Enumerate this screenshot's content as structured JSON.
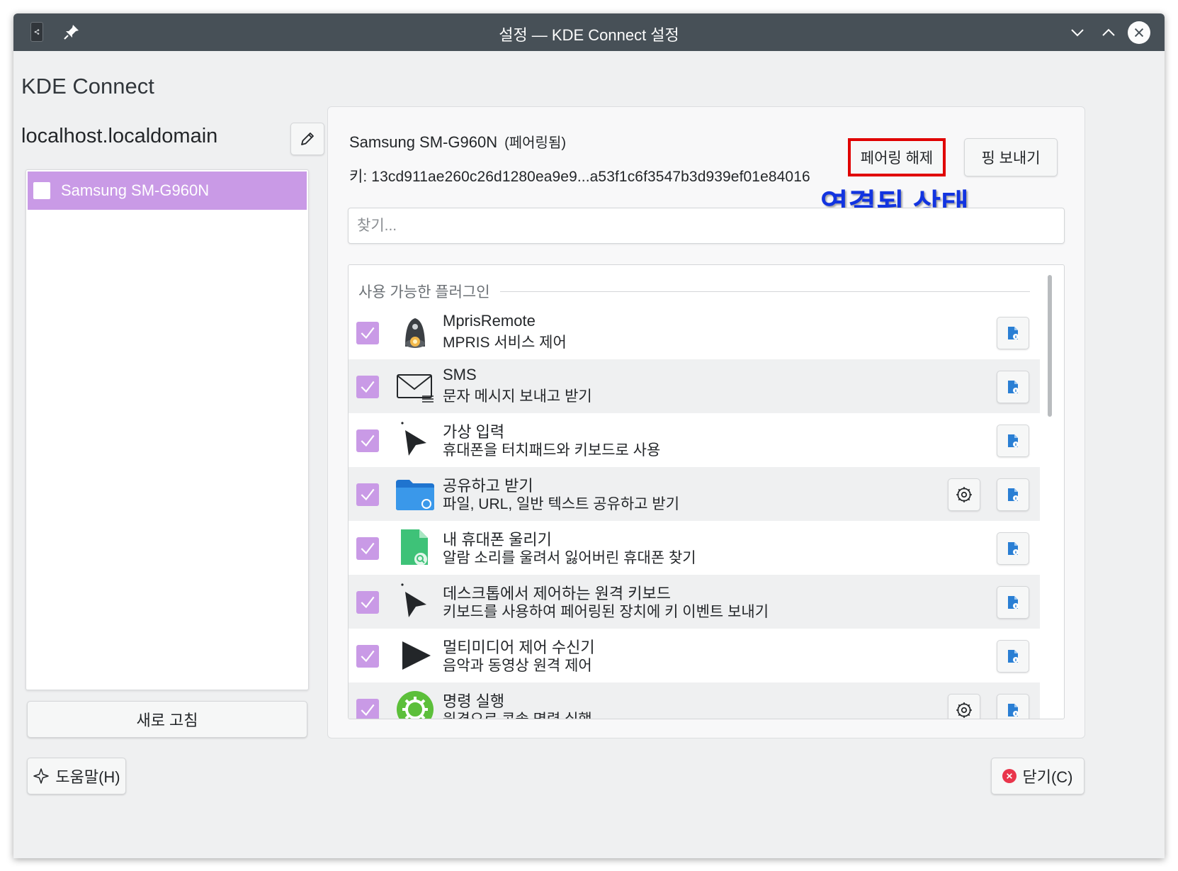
{
  "window": {
    "title": "설정 — KDE Connect 설정"
  },
  "app_heading": "KDE Connect",
  "host": {
    "name": "localhost.localdomain"
  },
  "devices": [
    {
      "label": "Samsung SM-G960N",
      "selected": true
    }
  ],
  "refresh_label": "새로 고침",
  "device_panel": {
    "name": "Samsung SM-G960N",
    "status": "(페어링됨)",
    "key_label": "키: 13cd911ae260c26d1280ea9e9...a53f1c6f3547b3d939ef01e84016",
    "unpair_label": "페어링 해제",
    "ping_label": "핑 보내기",
    "annotation": "연결된 상태",
    "search_placeholder": "찾기...",
    "section_title": "사용 가능한 플러그인"
  },
  "plugins": [
    {
      "name": "MprisRemote",
      "description": "MPRIS 서비스 제어",
      "enabled": true,
      "icon": "mpris-remote-icon",
      "has_settings": false
    },
    {
      "name": "SMS",
      "description": "문자 메시지 보내고 받기",
      "enabled": true,
      "icon": "envelope-icon",
      "has_settings": false
    },
    {
      "name": "가상 입력",
      "description": "휴대폰을 터치패드와 키보드로 사용",
      "enabled": true,
      "icon": "pointer-icon",
      "has_settings": false
    },
    {
      "name": "공유하고 받기",
      "description": "파일, URL, 일반 텍스트 공유하고 받기",
      "enabled": true,
      "icon": "folder-share-icon",
      "has_settings": true
    },
    {
      "name": "내 휴대폰 울리기",
      "description": "알람 소리를 울려서 잃어버린 휴대폰 찾기",
      "enabled": true,
      "icon": "find-phone-icon",
      "has_settings": false
    },
    {
      "name": "데스크톱에서 제어하는 원격 키보드",
      "description": "키보드를 사용하여 페어링된 장치에 키 이벤트 보내기",
      "enabled": true,
      "icon": "pointer-icon",
      "has_settings": false
    },
    {
      "name": "멀티미디어 제어 수신기",
      "description": "음악과 동영상 원격 제어",
      "enabled": true,
      "icon": "play-icon",
      "has_settings": false
    },
    {
      "name": "명령 실행",
      "description": "원격으로 콘솔 명령 실행",
      "enabled": true,
      "icon": "run-command-icon",
      "has_settings": true
    }
  ],
  "footer": {
    "help_label": "도움말(H)",
    "close_label": "닫기(C)"
  },
  "colors": {
    "accent": "#c99ae6",
    "titlebar": "#475057",
    "annotation": "#1234e0",
    "highlight_border": "#e00000"
  }
}
